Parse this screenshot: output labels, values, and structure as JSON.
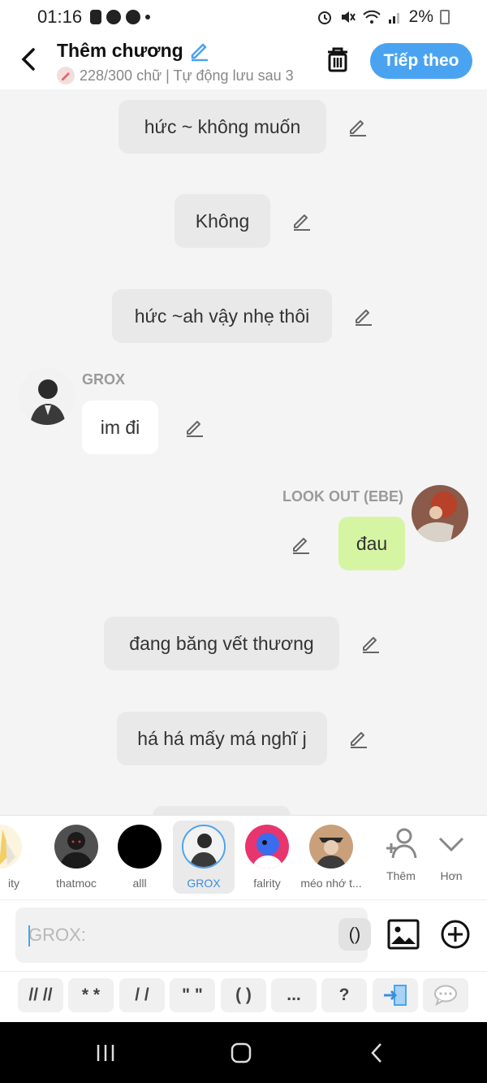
{
  "status_bar": {
    "time": "01:16",
    "battery": "2%",
    "left_icons": [
      "notification-icon",
      "facebook-icon",
      "facebook-icon",
      "dot-icon"
    ],
    "right_icons": [
      "alarm-icon",
      "mute-icon",
      "wifi-icon",
      "signal-icon",
      "battery-icon"
    ]
  },
  "header": {
    "title": "Thêm chương",
    "subtitle": "228/300 chữ | Tự động lưu sau 3",
    "next_button": "Tiếp theo",
    "accent": "#4aa3f0"
  },
  "messages": [
    {
      "text": "hức ~ không muốn",
      "style": "narration"
    },
    {
      "text": "Không",
      "style": "narration"
    },
    {
      "text": "hức ~ah vậy nhẹ thôi",
      "style": "narration"
    },
    {
      "speaker": "GROX",
      "text": "im đi",
      "side": "left"
    },
    {
      "speaker": "LOOK OUT (EBE)",
      "text": "đau",
      "side": "right"
    },
    {
      "text": "đang băng vết thương",
      "style": "narration"
    },
    {
      "text": "há há mấy má nghĩ j",
      "style": "narration"
    }
  ],
  "characters": [
    {
      "name": "ity",
      "selected": false
    },
    {
      "name": "thatmoc",
      "selected": false
    },
    {
      "name": "alll",
      "selected": false
    },
    {
      "name": "GROX",
      "selected": true
    },
    {
      "name": "falrity",
      "selected": false
    },
    {
      "name": "méo nhớ t..."
    }
  ],
  "tools": {
    "add_label": "Thêm",
    "more_label": "Hơn"
  },
  "input": {
    "placeholder": "GROX:",
    "paren_button": "()"
  },
  "format_buttons": [
    "// //",
    "* *",
    "/ /",
    "\" \"",
    "( )",
    "...",
    "?"
  ]
}
